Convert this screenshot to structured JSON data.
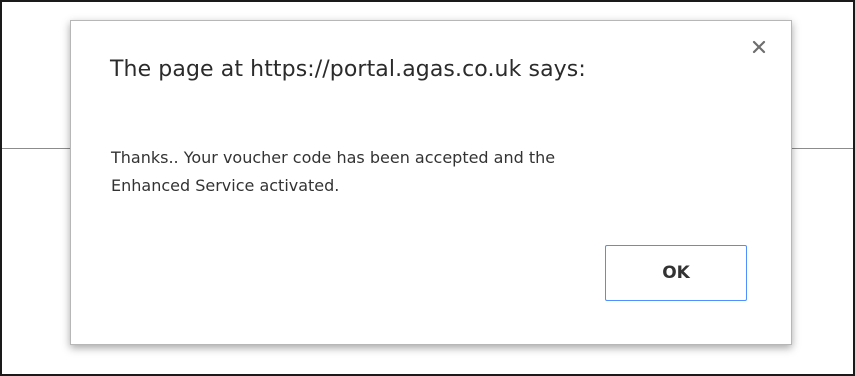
{
  "dialog": {
    "title": "The page at https://portal.agas.co.uk says:",
    "message": "Thanks.. Your voucher code has been accepted and the\nEnhanced Service activated.",
    "ok_label": "OK",
    "close_icon": "close-icon"
  }
}
